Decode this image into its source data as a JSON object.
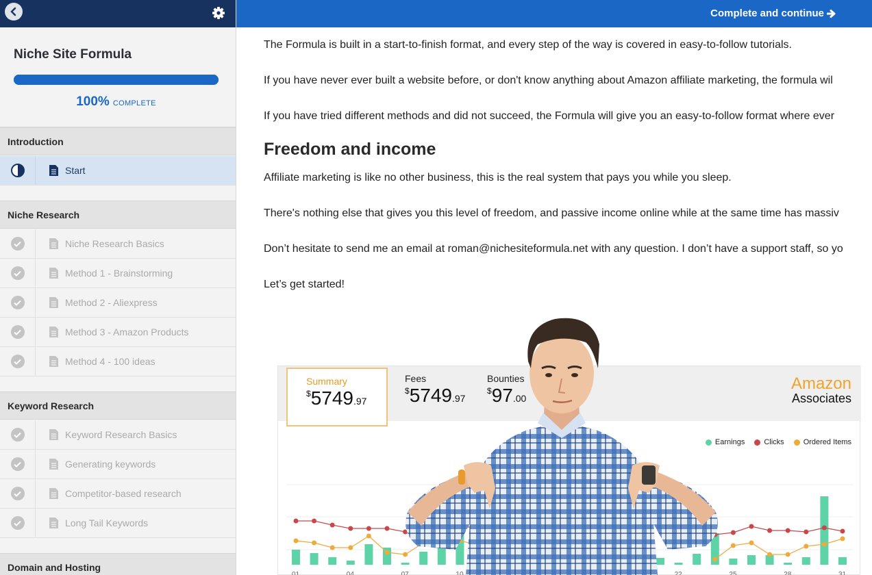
{
  "sidebar": {
    "course_title": "Niche Site Formula",
    "progress_percent": 100,
    "progress_label": "100%",
    "complete_word": "COMPLETE",
    "sections": [
      {
        "title": "Introduction",
        "lessons": [
          {
            "label": "Start",
            "status": "in-progress",
            "active": true
          }
        ]
      },
      {
        "title": "Niche Research",
        "lessons": [
          {
            "label": "Niche Research Basics",
            "status": "complete"
          },
          {
            "label": "Method 1 - Brainstorming",
            "status": "complete"
          },
          {
            "label": "Method 2 - Aliexpress",
            "status": "complete"
          },
          {
            "label": "Method 3 - Amazon Products",
            "status": "complete"
          },
          {
            "label": "Method 4 - 100 ideas",
            "status": "complete"
          }
        ]
      },
      {
        "title": "Keyword Research",
        "lessons": [
          {
            "label": "Keyword Research Basics",
            "status": "complete"
          },
          {
            "label": "Generating keywords",
            "status": "complete"
          },
          {
            "label": "Competitor-based research",
            "status": "complete"
          },
          {
            "label": "Long Tail Keywords",
            "status": "complete"
          }
        ]
      },
      {
        "title": "Domain and Hosting",
        "lessons": []
      }
    ]
  },
  "topbar": {
    "continue_label": "Complete and continue"
  },
  "main": {
    "p1": "The Formula is built in a start-to-finish format, and every step of the way is covered in easy-to-follow tutorials.",
    "p2": "If you have never ever built a website before, or don't know anything about Amazon affiliate marketing, the formula wil",
    "p3": "If you have tried different methods and did not succeed, the Formula will give you an easy-to-follow format where ever",
    "heading": "Freedom and income",
    "p4": "Affiliate marketing is like no other business, this is the real system that pays you while you sleep.",
    "p5": "There's nothing else that gives you this level of freedom, and passive income online while at the same time has massiv",
    "p6": "Don’t hesitate to send me an email at roman@nichesiteformula.net with any question. I don’t have a support staff, so yo",
    "p7": "Let’s get started!"
  },
  "dashboard": {
    "summary_label": "Summary",
    "summary_currency": "$",
    "summary_main": "5749",
    "summary_cents": ".97",
    "fees_label": "Fees",
    "fees_currency": "$",
    "fees_main": "5749",
    "fees_cents": ".97",
    "bounties_label": "Bounties",
    "bounties_currency": "$",
    "bounties_main": "97",
    "bounties_cents": ".00",
    "brand_line1": "Amazon",
    "brand_line2": "Associates",
    "legend": [
      "Earnings",
      "Clicks",
      "Ordered Items"
    ],
    "colors": {
      "earnings": "#5fd3a8",
      "clicks": "#c8474b",
      "ordered": "#eeaa3a"
    }
  },
  "chart_data": {
    "type": "bar",
    "x": [
      "01",
      "02",
      "03",
      "04",
      "05",
      "06",
      "07",
      "08",
      "09",
      "10",
      "11",
      "12",
      "13",
      "14",
      "15",
      "16",
      "17",
      "18",
      "19",
      "20",
      "21",
      "22",
      "23",
      "24",
      "25",
      "26",
      "27",
      "28",
      "29",
      "30",
      "31"
    ],
    "tick_labels": [
      "01",
      "04",
      "07",
      "10",
      "22",
      "25",
      "28",
      "31"
    ],
    "series": [
      {
        "name": "Earnings",
        "type": "bar",
        "values": [
          22,
          17,
          11,
          6,
          30,
          25,
          3,
          19,
          68,
          60,
          8,
          10,
          0,
          0,
          0,
          0,
          0,
          0,
          0,
          10,
          10,
          3,
          16,
          46,
          9,
          14,
          14,
          3,
          11,
          100,
          11
        ]
      },
      {
        "name": "Clicks",
        "type": "line",
        "values": [
          64,
          64,
          58,
          53,
          53,
          53,
          48,
          54,
          56,
          56,
          54,
          0,
          0,
          0,
          0,
          0,
          0,
          0,
          0,
          0,
          0,
          0,
          0,
          44,
          47,
          56,
          50,
          50,
          48,
          54,
          49
        ]
      },
      {
        "name": "Ordered Items",
        "type": "line",
        "values": [
          35,
          32,
          25,
          25,
          42,
          18,
          15,
          32,
          32,
          35,
          29,
          0,
          0,
          0,
          0,
          0,
          0,
          0,
          0,
          0,
          0,
          0,
          0,
          8,
          28,
          32,
          15,
          15,
          27,
          30,
          38
        ]
      }
    ]
  }
}
